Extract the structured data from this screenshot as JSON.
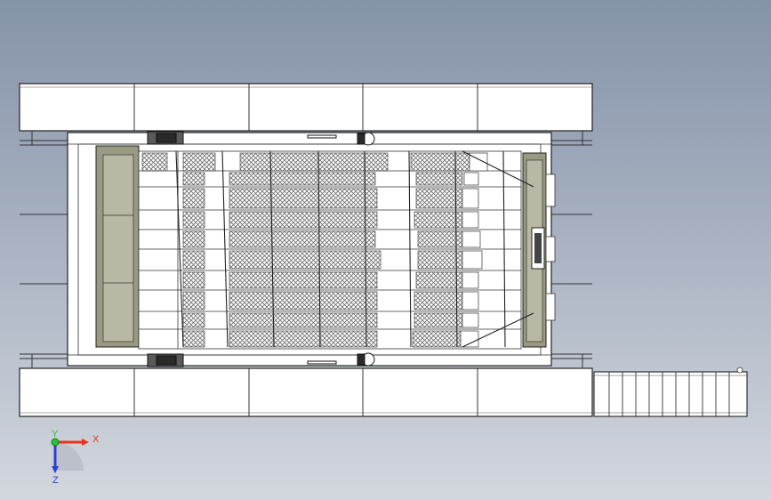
{
  "triad": {
    "x_label": "X",
    "y_label": "Y",
    "z_label": "Z",
    "x_color": "#e8341c",
    "y_color": "#27c13a",
    "z_color": "#2b3fd6"
  },
  "colors": {
    "background_top": "#8593a8",
    "background_bottom": "#d3d7de",
    "line": "#2a2a2a",
    "panel": "#ffffff",
    "olive": "#9a9a82",
    "mesh": "#8a8a8a"
  }
}
